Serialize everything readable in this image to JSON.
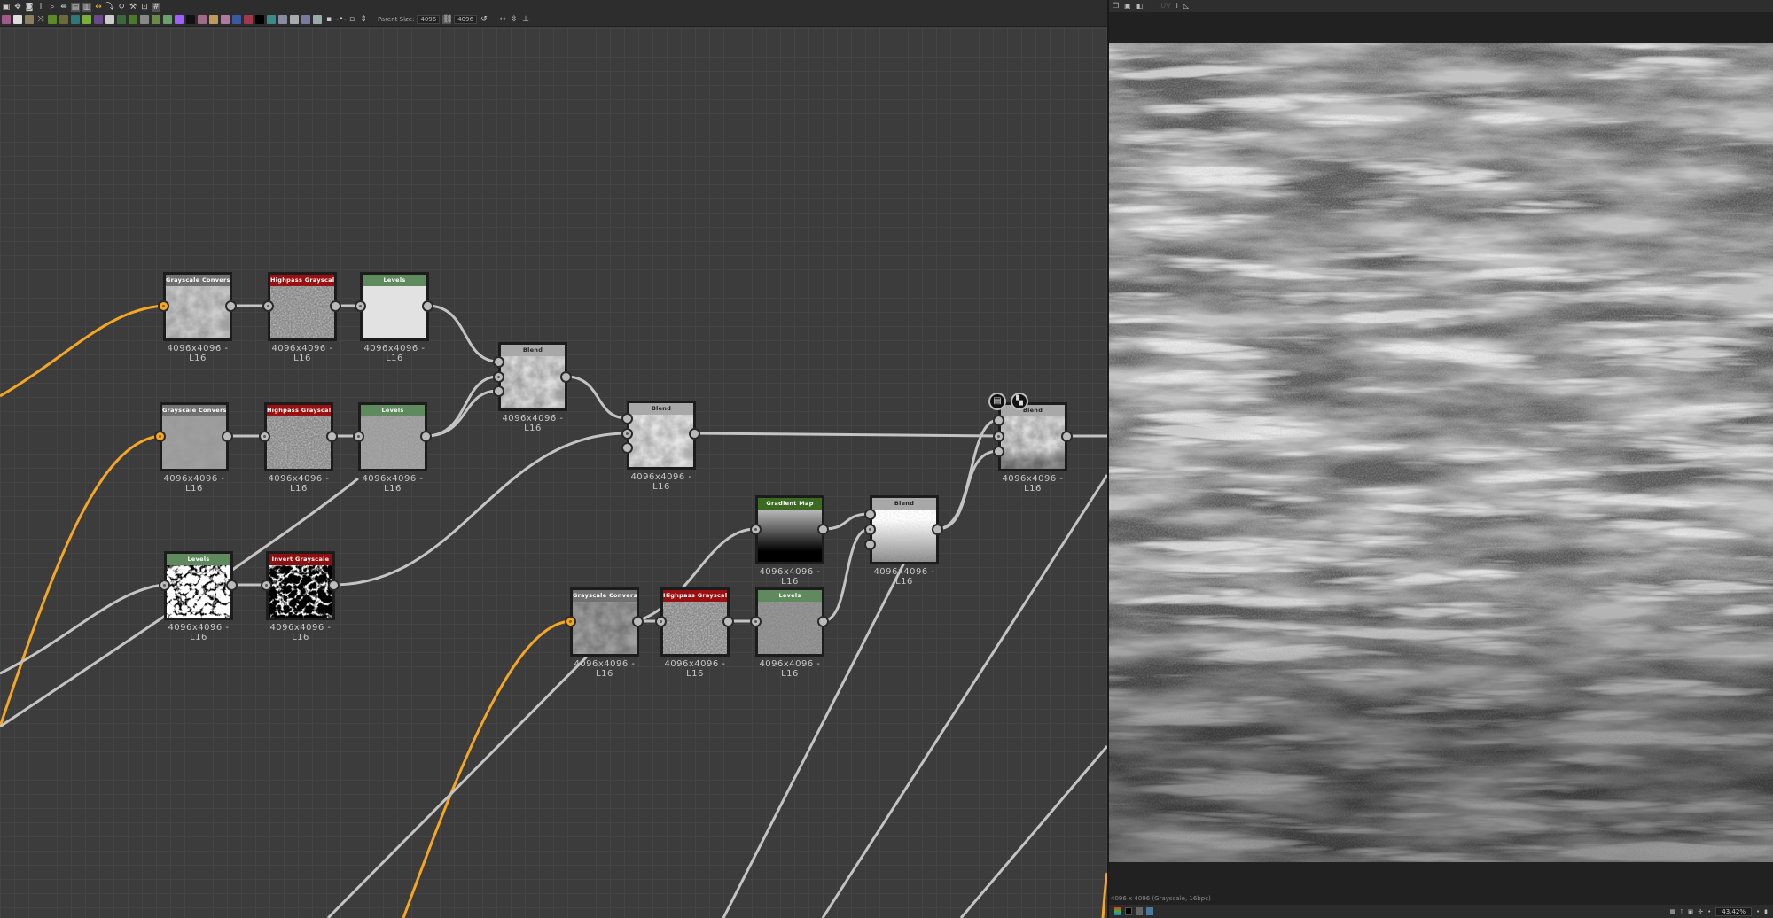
{
  "toolbar": {
    "parent_size_label": "Parent Size:",
    "parent_size_value": "4096",
    "size_value": "4096"
  },
  "nodes": [
    {
      "id": "gc1",
      "title": "Grayscale Convers...",
      "res": "4096x4096 - L16"
    },
    {
      "id": "hp1",
      "title": "Highpass Grayscale",
      "res": "4096x4096 - L16"
    },
    {
      "id": "lv1",
      "title": "Levels",
      "res": "4096x4096 - L16"
    },
    {
      "id": "gc2",
      "title": "Grayscale Convers...",
      "res": "4096x4096 - L16"
    },
    {
      "id": "hp2",
      "title": "Highpass Grayscale",
      "res": "4096x4096 - L16"
    },
    {
      "id": "lv2",
      "title": "Levels",
      "res": "4096x4096 - L16"
    },
    {
      "id": "bl1",
      "title": "Blend",
      "res": "4096x4096 - L16"
    },
    {
      "id": "bl2",
      "title": "Blend",
      "res": "4096x4096 - L16"
    },
    {
      "id": "bl3",
      "title": "Blend",
      "res": "4096x4096 - L16"
    },
    {
      "id": "lv3",
      "title": "Levels",
      "res": "4096x4096 - L16"
    },
    {
      "id": "inv",
      "title": "Invert Grayscale",
      "res": "4096x4096 - L16"
    },
    {
      "id": "gm",
      "title": "Gradient Map",
      "res": "4096x4096 - L16"
    },
    {
      "id": "bl4",
      "title": "Blend",
      "res": "4096x4096 - L16"
    },
    {
      "id": "gc3",
      "title": "Grayscale Convers...",
      "res": "4096x4096 - L16"
    },
    {
      "id": "hp3",
      "title": "Highpass Grayscale",
      "res": "4096x4096 - L16"
    },
    {
      "id": "lv4",
      "title": "Levels",
      "res": "4096x4096 - L16"
    }
  ],
  "colors": {
    "grayscale": "#707070",
    "highpass": "#9a1010",
    "levels": "#5e8a5e",
    "blend": "#a8a8a8",
    "invert": "#8e0f0f",
    "gradient": "#3d6a22",
    "wire": "#c4c4c4",
    "wire_input": "#f5a623"
  },
  "viewer": {
    "uv_label": "UV",
    "info": "4096 x 4096 (Grayscale, 16bpc)",
    "zoom": "43.42%"
  }
}
